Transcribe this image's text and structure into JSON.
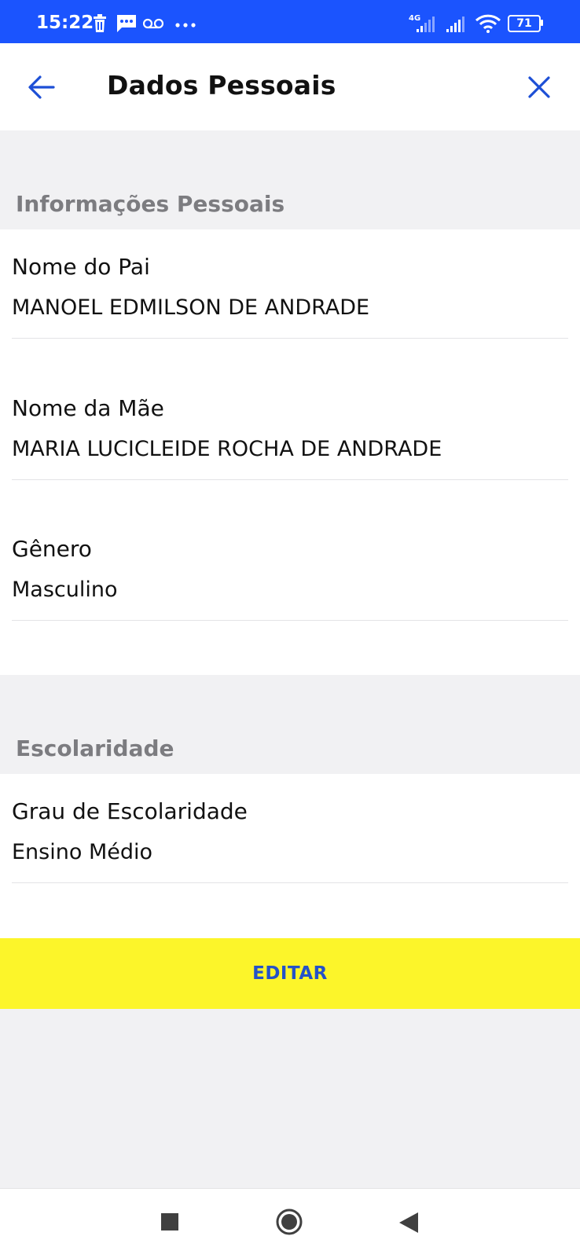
{
  "status_bar": {
    "time": "15:22",
    "left_icons": [
      "trash-icon",
      "message-icon",
      "voicemail-icon",
      "more-dots-icon"
    ],
    "network": "4G",
    "battery": "71"
  },
  "header": {
    "title": "Dados Pessoais",
    "back_icon": "arrow-left-icon",
    "close_icon": "close-icon"
  },
  "sections": {
    "personal": {
      "label": "Informações Pessoais",
      "fields": [
        {
          "label": "Nome do Pai",
          "value": "MANOEL EDMILSON DE ANDRADE"
        },
        {
          "label": "Nome da Mãe",
          "value": "MARIA LUCICLEIDE ROCHA DE ANDRADE"
        },
        {
          "label": "Gênero",
          "value": "Masculino"
        }
      ]
    },
    "education": {
      "label": "Escolaridade",
      "fields": [
        {
          "label": "Grau de Escolaridade",
          "value": "Ensino Médio"
        }
      ]
    }
  },
  "actions": {
    "edit_label": "EDITAR"
  },
  "colors": {
    "status_bar": "#1b54fe",
    "accent": "#1d4fd6",
    "edit_button_bg": "#fcf52a",
    "edit_button_text": "#2452c8",
    "section_label": "#7c7c80",
    "background": "#f1f1f3"
  }
}
